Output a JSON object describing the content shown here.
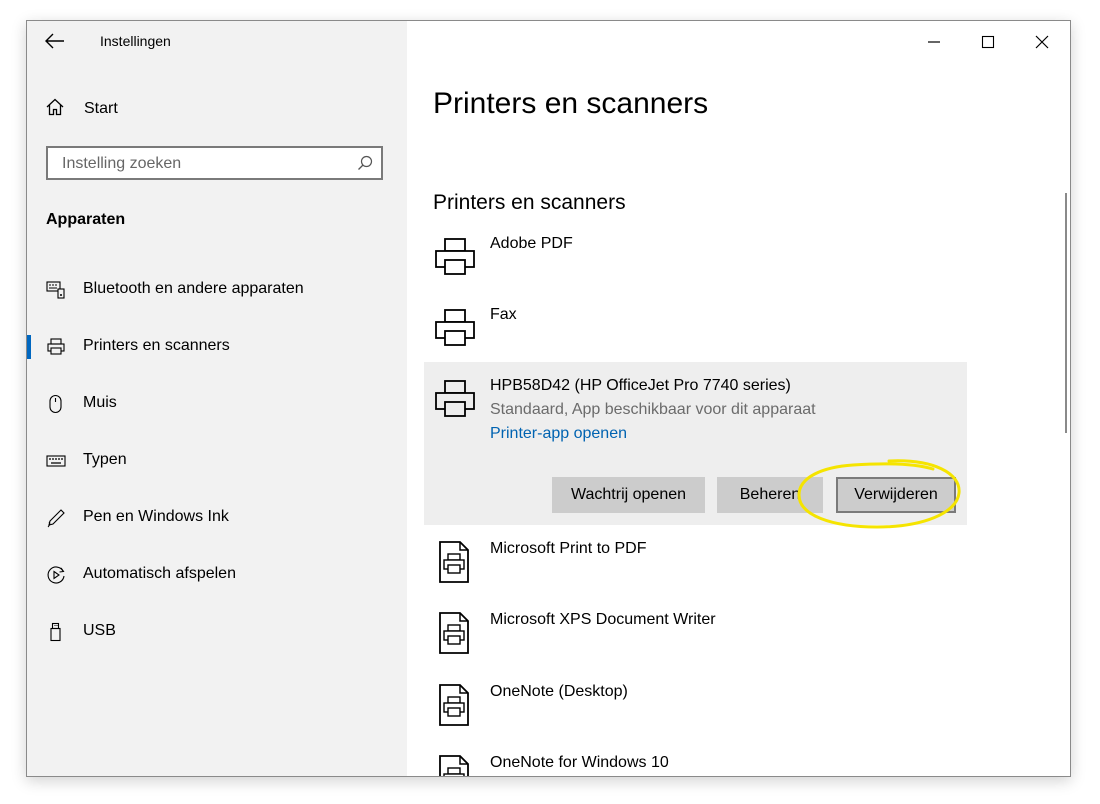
{
  "app": {
    "title": "Instellingen"
  },
  "window_controls": {
    "minimize": "minimize-icon",
    "maximize": "maximize-icon",
    "close": "close-icon"
  },
  "sidebar": {
    "home_label": "Start",
    "search_placeholder": "Instelling zoeken",
    "section_title": "Apparaten",
    "items": [
      {
        "label": "Bluetooth en andere apparaten",
        "icon": "bluetooth-devices-icon",
        "selected": false
      },
      {
        "label": "Printers en scanners",
        "icon": "printer-icon",
        "selected": true
      },
      {
        "label": "Muis",
        "icon": "mouse-icon",
        "selected": false
      },
      {
        "label": "Typen",
        "icon": "keyboard-icon",
        "selected": false
      },
      {
        "label": "Pen en Windows Ink",
        "icon": "pen-icon",
        "selected": false
      },
      {
        "label": "Automatisch afspelen",
        "icon": "autoplay-icon",
        "selected": false
      },
      {
        "label": "USB",
        "icon": "usb-icon",
        "selected": false
      }
    ]
  },
  "main": {
    "page_title": "Printers en scanners",
    "section_title": "Printers en scanners",
    "printers": [
      {
        "name": "Adobe PDF",
        "icon": "printer-icon"
      },
      {
        "name": "Fax",
        "icon": "printer-icon"
      },
      {
        "name": "HPB58D42 (HP OfficeJet Pro 7740 series)",
        "icon": "printer-icon",
        "status": "Standaard, App beschikbaar voor dit apparaat",
        "link": "Printer-app openen",
        "selected": true
      },
      {
        "name": "Microsoft Print to PDF",
        "icon": "document-printer-icon"
      },
      {
        "name": "Microsoft XPS Document Writer",
        "icon": "document-printer-icon"
      },
      {
        "name": "OneNote (Desktop)",
        "icon": "document-printer-icon"
      },
      {
        "name": "OneNote for Windows 10",
        "icon": "document-printer-icon"
      }
    ],
    "buttons": {
      "queue": "Wachtrij openen",
      "manage": "Beheren",
      "remove": "Verwijderen"
    }
  },
  "colors": {
    "accent": "#0067c0",
    "link": "#0063b1",
    "highlight": "#f5e400"
  }
}
